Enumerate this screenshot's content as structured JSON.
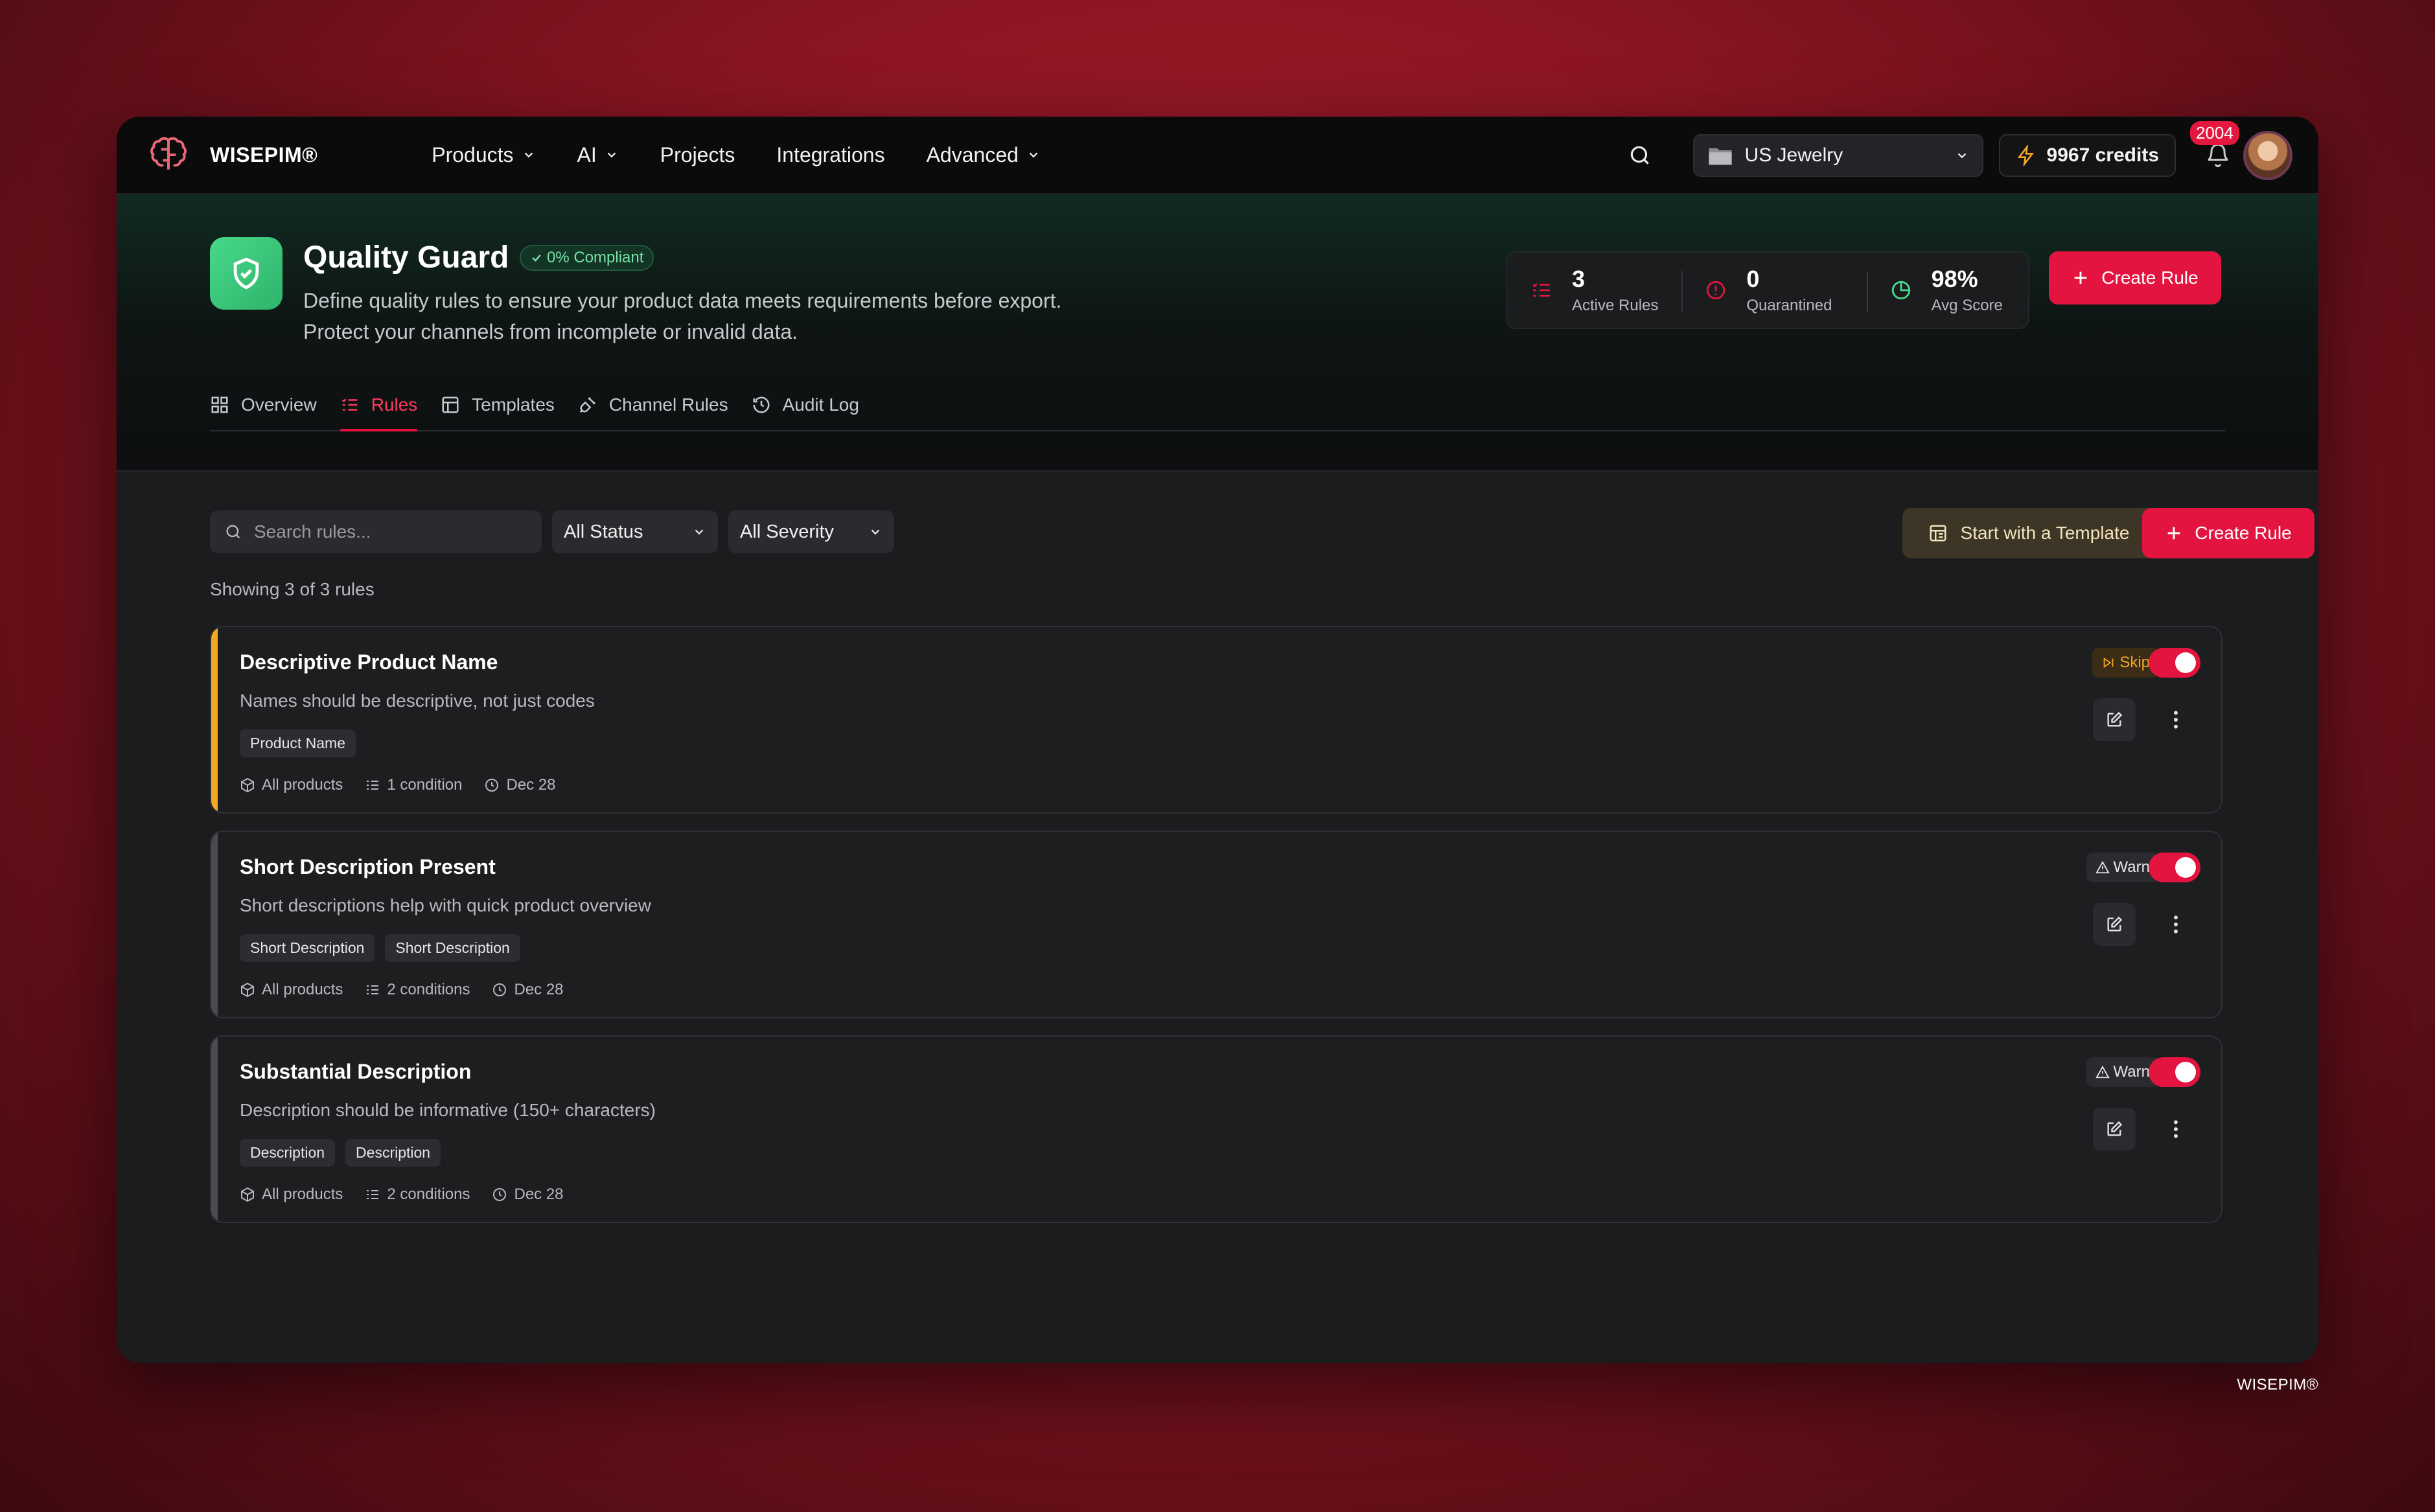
{
  "brand": {
    "name": "WISEPIM®"
  },
  "nav": {
    "items": [
      {
        "label": "Products",
        "has_dropdown": true
      },
      {
        "label": "AI",
        "has_dropdown": true
      },
      {
        "label": "Projects",
        "has_dropdown": false
      },
      {
        "label": "Integrations",
        "has_dropdown": false
      },
      {
        "label": "Advanced",
        "has_dropdown": true
      }
    ],
    "workspace": "US Jewelry",
    "credits": "9967 credits",
    "notification_count": "2004"
  },
  "hero": {
    "title": "Quality Guard",
    "compliance_badge": "0% Compliant",
    "description": "Define quality rules to ensure your product data meets requirements before export. Protect your channels from incomplete or invalid data.",
    "stats": [
      {
        "value": "3",
        "label": "Active Rules"
      },
      {
        "value": "0",
        "label": "Quarantined"
      },
      {
        "value": "98%",
        "label": "Avg Score"
      }
    ],
    "create_label": "Create Rule"
  },
  "tabs": [
    {
      "label": "Overview",
      "icon": "grid-icon",
      "active": false
    },
    {
      "label": "Rules",
      "icon": "list-icon",
      "active": true
    },
    {
      "label": "Templates",
      "icon": "template-icon",
      "active": false
    },
    {
      "label": "Channel Rules",
      "icon": "plug-icon",
      "active": false
    },
    {
      "label": "Audit Log",
      "icon": "history-icon",
      "active": false
    }
  ],
  "filters": {
    "search_placeholder": "Search rules...",
    "status": "All Status",
    "severity": "All Severity",
    "template_label": "Start with a Template",
    "create_label": "Create Rule"
  },
  "showing": "Showing 3 of 3 rules",
  "rules": [
    {
      "title": "Descriptive Product Name",
      "description": "Names should be descriptive, not just codes",
      "tags": [
        "Product Name"
      ],
      "scope": "All products",
      "conditions": "1 condition",
      "date": "Dec 28",
      "action": "Skip",
      "enabled": true,
      "accent": "#f3a722"
    },
    {
      "title": "Short Description Present",
      "description": "Short descriptions help with quick product overview",
      "tags": [
        "Short Description",
        "Short Description"
      ],
      "scope": "All products",
      "conditions": "2 conditions",
      "date": "Dec 28",
      "action": "Warn",
      "enabled": true,
      "accent": "#4a4b4f"
    },
    {
      "title": "Substantial Description",
      "description": "Description should be informative (150+ characters)",
      "tags": [
        "Description",
        "Description"
      ],
      "scope": "All products",
      "conditions": "2 conditions",
      "date": "Dec 28",
      "action": "Warn",
      "enabled": true,
      "accent": "#4a4b4f"
    }
  ],
  "footer": "WISEPIM®",
  "colors": {
    "accent_red": "#e3143f",
    "success_green": "#47d98a",
    "warning_orange": "#f3a722"
  }
}
